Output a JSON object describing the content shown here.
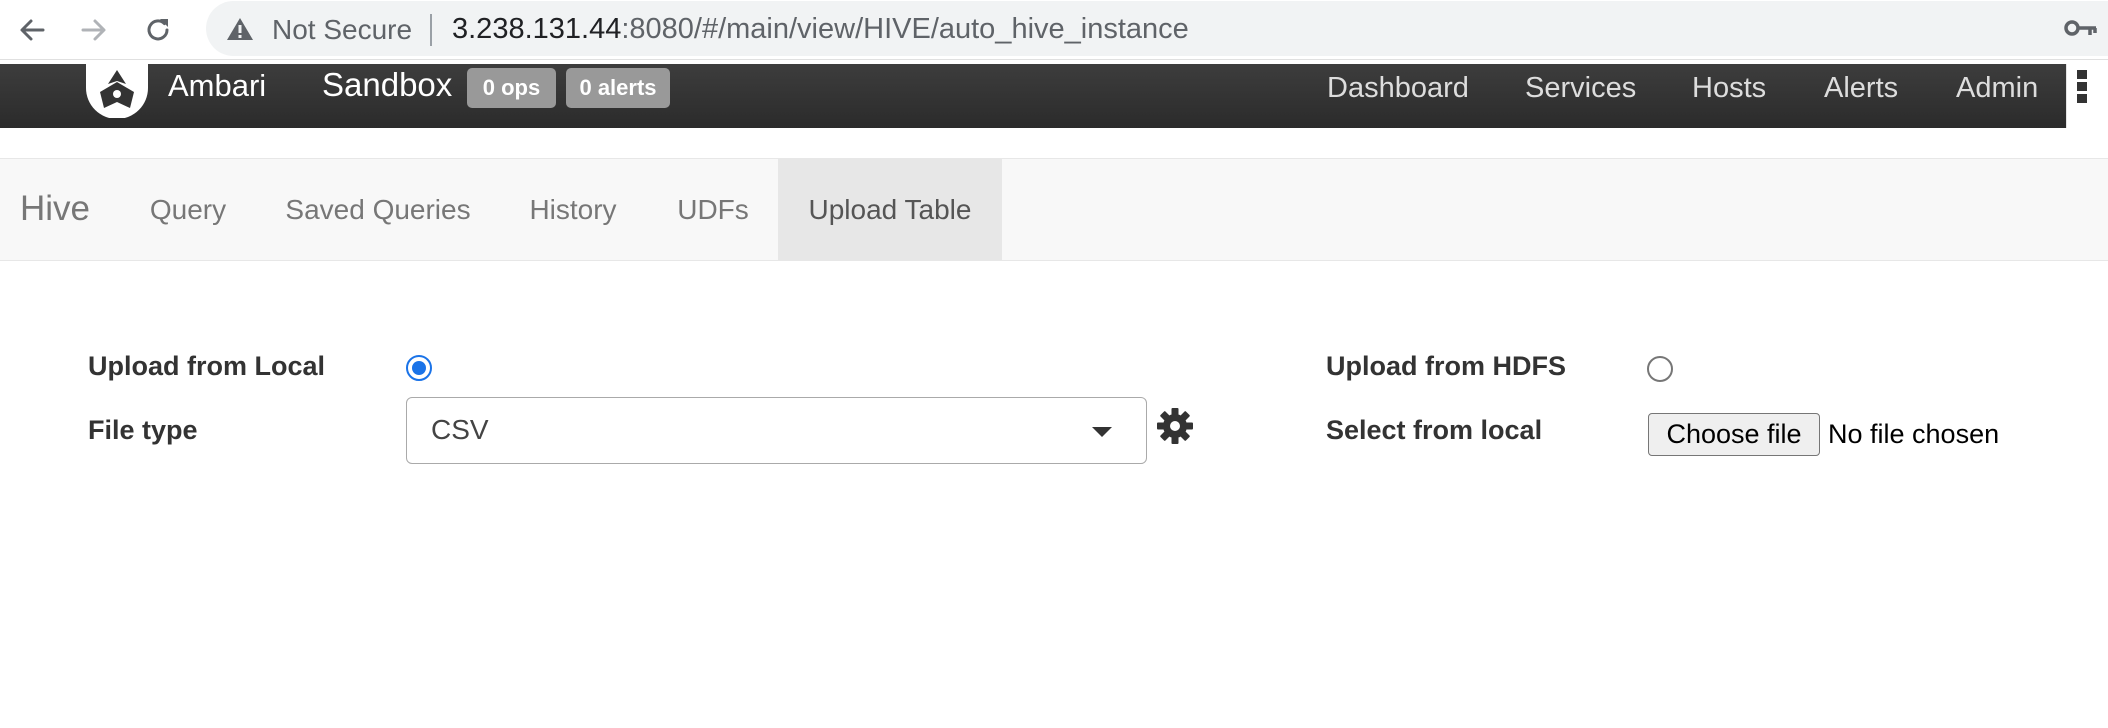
{
  "browser": {
    "security_label": "Not Secure",
    "url_host": "3.238.131.44",
    "url_rest": ":8080/#/main/view/HIVE/auto_hive_instance"
  },
  "topnav": {
    "brand": "Ambari",
    "cluster": "Sandbox",
    "ops_badge": "0 ops",
    "alerts_badge": "0 alerts",
    "links": {
      "dashboard": "Dashboard",
      "services": "Services",
      "hosts": "Hosts",
      "alerts": "Alerts",
      "admin": "Admin"
    }
  },
  "hive_nav": {
    "brand": "Hive",
    "tabs": {
      "query": "Query",
      "saved_queries": "Saved Queries",
      "history": "History",
      "udfs": "UDFs",
      "upload_table": "Upload Table"
    },
    "active_tab": "upload_table"
  },
  "form": {
    "upload_local_label": "Upload from Local",
    "upload_local_selected": true,
    "file_type_label": "File type",
    "file_type_value": "CSV",
    "upload_hdfs_label": "Upload from HDFS",
    "upload_hdfs_selected": false,
    "select_local_label": "Select from local",
    "choose_file_button": "Choose file",
    "no_file_text": "No file chosen"
  },
  "colors": {
    "topnav_bg": "#333333",
    "badge_bg": "#999999",
    "radio_selected": "#1a73e8",
    "active_tab_bg": "#e7e7e7"
  },
  "icons": [
    "back-arrow-icon",
    "forward-arrow-icon",
    "reload-icon",
    "warning-icon",
    "key-icon",
    "ambari-logo-icon",
    "menu-grid-icon",
    "gear-icon",
    "chevron-down-icon"
  ]
}
